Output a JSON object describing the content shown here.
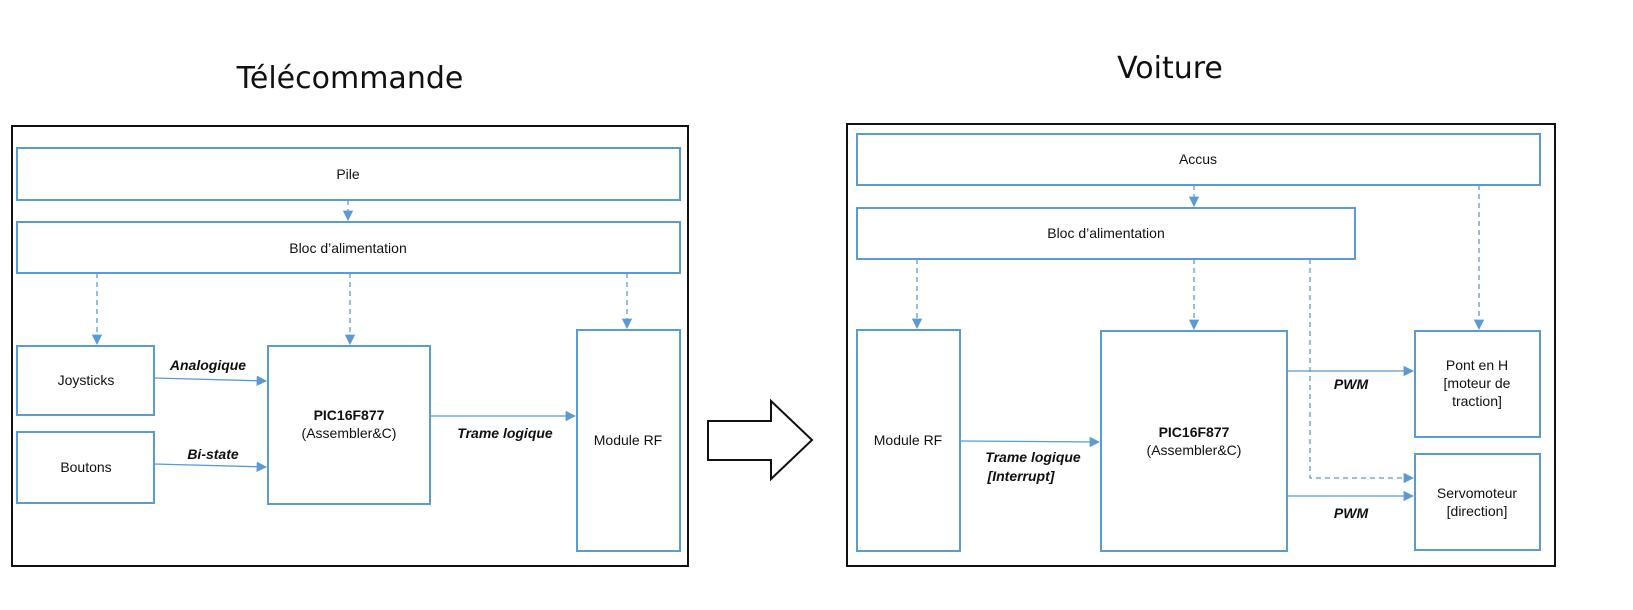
{
  "titles": {
    "left": "Télécommande",
    "right": "Voiture"
  },
  "telecommande": {
    "pile": "Pile",
    "bloc_alim": "Bloc d’alimentation",
    "joysticks": "Joysticks",
    "boutons": "Boutons",
    "pic_name": "PIC16F877",
    "pic_sub": "(Assembler&C)",
    "module_rf": "Module RF",
    "edges": {
      "analogique": "Analogique",
      "bistate": "Bi-state",
      "trame": "Trame logique"
    }
  },
  "voiture": {
    "accus": "Accus",
    "bloc_alim": "Bloc d’alimentation",
    "module_rf": "Module RF",
    "pic_name": "PIC16F877",
    "pic_sub": "(Assembler&C)",
    "pont_line1": "Pont en H",
    "pont_line2": "[moteur de",
    "pont_line3": "traction]",
    "servo_line1": "Servomoteur",
    "servo_line2": "[direction]",
    "edges": {
      "trame_line1": "Trame logique",
      "trame_line2": "[Interrupt]",
      "pwm1": "PWM",
      "pwm2": "PWM"
    }
  },
  "colors": {
    "block_stroke": "#5b9bd5",
    "frame_stroke": "#111111",
    "arrow": "#5b9bd5"
  }
}
